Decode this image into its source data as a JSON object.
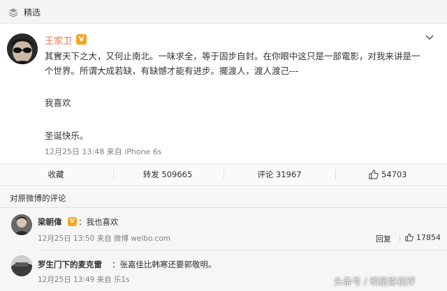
{
  "topbar": {
    "label": "精选"
  },
  "post": {
    "author": "王家卫",
    "vip_badge": "V",
    "text_lines": [
      "其實天下之大，又何止南北。一味求全，等于固步自封。在你眼中这只是一部電影，对我来讲是一",
      "个世界。所谓大成若缺，有缺憾才能有进步。擺渡人，渡人渡己---"
    ],
    "para_2": "我喜欢",
    "para_3": "圣诞快乐。",
    "meta": "12月25日 13:48 来自 iPhone 6s"
  },
  "actions": {
    "collect": "收藏",
    "repost": "转发 509665",
    "comment": "评论 31967",
    "like": "54703"
  },
  "comments": {
    "title": "对原微博的评论",
    "items": [
      {
        "name": "梁朝偉",
        "vip_badge": "V",
        "text": "：我也喜欢",
        "meta": "12月25日 13:50 来自 微博 weibo.com",
        "reply": "回复",
        "likes": "17854"
      },
      {
        "name": "罗生门下的麦克雷",
        "text": "：张嘉佳比韩寒还要郭敬明。",
        "meta": "12月25日 13:49 来自 乐1s"
      }
    ]
  },
  "watermark": "头条号 / 明星影视评",
  "colors": {
    "author": "#eb7350",
    "vip": "#f5a623",
    "meta": "#808080"
  }
}
